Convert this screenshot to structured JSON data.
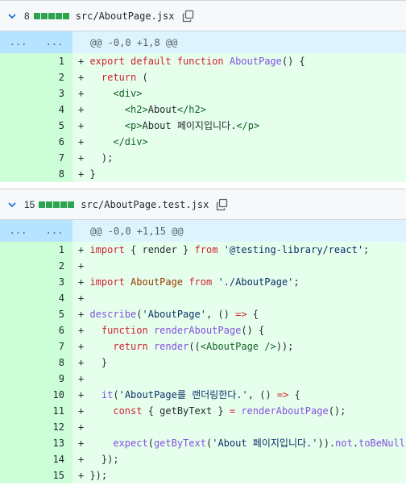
{
  "files": [
    {
      "count": "8",
      "filename": "src/AboutPage.jsx",
      "hunk": {
        "left": "...",
        "right": "...",
        "header": "@@ -0,0 +1,8 @@"
      },
      "lines": [
        {
          "num": "1",
          "tokens": [
            [
              "kw",
              "export default function "
            ],
            [
              "fn",
              "AboutPage"
            ],
            [
              "plain",
              "() {"
            ]
          ]
        },
        {
          "num": "2",
          "tokens": [
            [
              "plain",
              "  "
            ],
            [
              "kw",
              "return"
            ],
            [
              "plain",
              " ("
            ]
          ]
        },
        {
          "num": "3",
          "tokens": [
            [
              "plain",
              "    "
            ],
            [
              "tag",
              "<div>"
            ]
          ]
        },
        {
          "num": "4",
          "tokens": [
            [
              "plain",
              "      "
            ],
            [
              "tag",
              "<h2>"
            ],
            [
              "plain",
              "About"
            ],
            [
              "tag",
              "</h2>"
            ]
          ]
        },
        {
          "num": "5",
          "tokens": [
            [
              "plain",
              "      "
            ],
            [
              "tag",
              "<p>"
            ],
            [
              "plain",
              "About 페이지입니다."
            ],
            [
              "tag",
              "</p>"
            ]
          ]
        },
        {
          "num": "6",
          "tokens": [
            [
              "plain",
              "    "
            ],
            [
              "tag",
              "</div>"
            ]
          ]
        },
        {
          "num": "7",
          "tokens": [
            [
              "plain",
              "  );"
            ]
          ]
        },
        {
          "num": "8",
          "tokens": [
            [
              "plain",
              "}"
            ]
          ]
        }
      ]
    },
    {
      "count": "15",
      "filename": "src/AboutPage.test.jsx",
      "hunk": {
        "left": "...",
        "right": "...",
        "header": "@@ -0,0 +1,15 @@"
      },
      "lines": [
        {
          "num": "1",
          "tokens": [
            [
              "kw",
              "import"
            ],
            [
              "plain",
              " { render } "
            ],
            [
              "kw",
              "from"
            ],
            [
              "plain",
              " "
            ],
            [
              "str",
              "'@testing-library/react'"
            ],
            [
              "plain",
              ";"
            ]
          ]
        },
        {
          "num": "2",
          "tokens": []
        },
        {
          "num": "3",
          "tokens": [
            [
              "kw",
              "import"
            ],
            [
              "plain",
              " "
            ],
            [
              "jsx",
              "AboutPage"
            ],
            [
              "plain",
              " "
            ],
            [
              "kw",
              "from"
            ],
            [
              "plain",
              " "
            ],
            [
              "str",
              "'./AboutPage'"
            ],
            [
              "plain",
              ";"
            ]
          ]
        },
        {
          "num": "4",
          "tokens": []
        },
        {
          "num": "5",
          "tokens": [
            [
              "fn",
              "describe"
            ],
            [
              "plain",
              "("
            ],
            [
              "str",
              "'AboutPage'"
            ],
            [
              "plain",
              ", () "
            ],
            [
              "kw",
              "=>"
            ],
            [
              "plain",
              " {"
            ]
          ]
        },
        {
          "num": "6",
          "tokens": [
            [
              "plain",
              "  "
            ],
            [
              "kw",
              "function"
            ],
            [
              "plain",
              " "
            ],
            [
              "fn",
              "renderAboutPage"
            ],
            [
              "plain",
              "() {"
            ]
          ]
        },
        {
          "num": "7",
          "tokens": [
            [
              "plain",
              "    "
            ],
            [
              "kw",
              "return"
            ],
            [
              "plain",
              " "
            ],
            [
              "fn",
              "render"
            ],
            [
              "plain",
              "(("
            ],
            [
              "tag",
              "<AboutPage />"
            ],
            [
              "plain",
              "));"
            ]
          ]
        },
        {
          "num": "8",
          "tokens": [
            [
              "plain",
              "  }"
            ]
          ]
        },
        {
          "num": "9",
          "tokens": []
        },
        {
          "num": "10",
          "tokens": [
            [
              "plain",
              "  "
            ],
            [
              "fn",
              "it"
            ],
            [
              "plain",
              "("
            ],
            [
              "str",
              "'AboutPage를 랜더링한다.'"
            ],
            [
              "plain",
              ", () "
            ],
            [
              "kw",
              "=>"
            ],
            [
              "plain",
              " {"
            ]
          ]
        },
        {
          "num": "11",
          "tokens": [
            [
              "plain",
              "    "
            ],
            [
              "kw",
              "const"
            ],
            [
              "plain",
              " { getByText } "
            ],
            [
              "kw",
              "="
            ],
            [
              "plain",
              " "
            ],
            [
              "fn",
              "renderAboutPage"
            ],
            [
              "plain",
              "();"
            ]
          ]
        },
        {
          "num": "12",
          "tokens": []
        },
        {
          "num": "13",
          "tokens": [
            [
              "plain",
              "    "
            ],
            [
              "fn",
              "expect"
            ],
            [
              "plain",
              "("
            ],
            [
              "fn",
              "getByText"
            ],
            [
              "plain",
              "("
            ],
            [
              "str",
              "'About 페이지입니다.'"
            ],
            [
              "plain",
              "))."
            ],
            [
              "fn",
              "not"
            ],
            [
              "plain",
              "."
            ],
            [
              "fn",
              "toBeNull"
            ],
            [
              "plain",
              "();"
            ]
          ]
        },
        {
          "num": "14",
          "tokens": [
            [
              "plain",
              "  });"
            ]
          ]
        },
        {
          "num": "15",
          "tokens": [
            [
              "plain",
              "});"
            ]
          ]
        }
      ]
    }
  ],
  "colors": {
    "added_bg": "#e6ffec",
    "added_num_bg": "#ccffd8",
    "hunk_bg": "#ddf4ff",
    "stat_green": "#2da44e"
  },
  "icons": {
    "collapse": "chevron-down-icon",
    "copy": "copy-icon"
  }
}
